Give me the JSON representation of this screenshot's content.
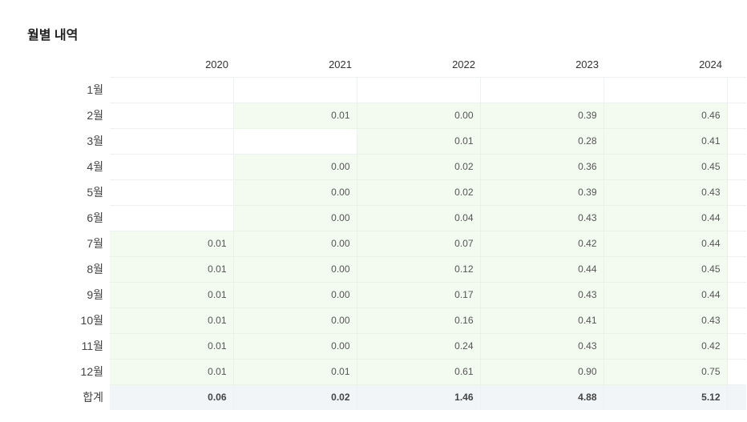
{
  "section": {
    "title": "월별 내역"
  },
  "table": {
    "years": [
      "2020",
      "2021",
      "2022",
      "2023",
      "2024"
    ],
    "rows": [
      {
        "label": "1월",
        "values": [
          "",
          "",
          "",
          "",
          ""
        ]
      },
      {
        "label": "2월",
        "values": [
          "",
          "0.01",
          "0.00",
          "0.39",
          "0.46"
        ]
      },
      {
        "label": "3월",
        "values": [
          "",
          "",
          "0.01",
          "0.28",
          "0.41"
        ]
      },
      {
        "label": "4월",
        "values": [
          "",
          "0.00",
          "0.02",
          "0.36",
          "0.45"
        ]
      },
      {
        "label": "5월",
        "values": [
          "",
          "0.00",
          "0.02",
          "0.39",
          "0.43"
        ]
      },
      {
        "label": "6월",
        "values": [
          "",
          "0.00",
          "0.04",
          "0.43",
          "0.44"
        ]
      },
      {
        "label": "7월",
        "values": [
          "0.01",
          "0.00",
          "0.07",
          "0.42",
          "0.44"
        ]
      },
      {
        "label": "8월",
        "values": [
          "0.01",
          "0.00",
          "0.12",
          "0.44",
          "0.45"
        ]
      },
      {
        "label": "9월",
        "values": [
          "0.01",
          "0.00",
          "0.17",
          "0.43",
          "0.44"
        ]
      },
      {
        "label": "10월",
        "values": [
          "0.01",
          "0.00",
          "0.16",
          "0.41",
          "0.43"
        ]
      },
      {
        "label": "11월",
        "values": [
          "0.01",
          "0.00",
          "0.24",
          "0.43",
          "0.42"
        ]
      },
      {
        "label": "12월",
        "values": [
          "0.01",
          "0.01",
          "0.61",
          "0.90",
          "0.75"
        ]
      }
    ],
    "total": {
      "label": "합계",
      "values": [
        "0.06",
        "0.02",
        "1.46",
        "4.88",
        "5.12"
      ]
    }
  },
  "colors": {
    "filled_cell": "#f3faef",
    "total_row": "#f2f5f8",
    "grid_line": "#eef1f4"
  }
}
